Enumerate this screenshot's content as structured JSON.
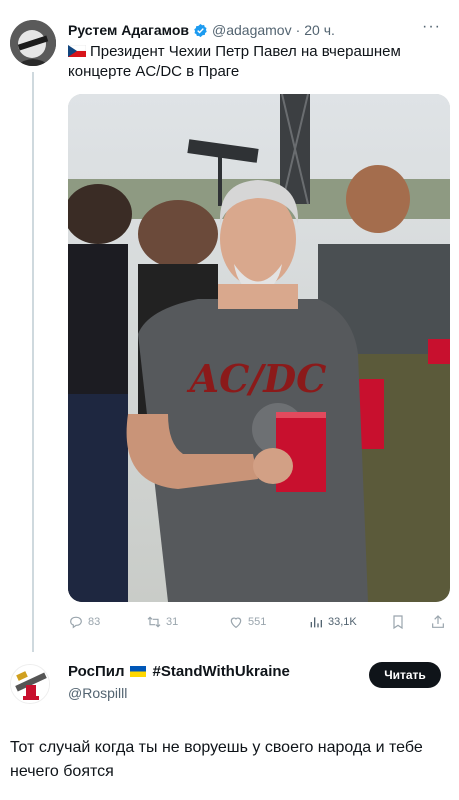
{
  "tweet": {
    "author_name": "Рустем Адагамов",
    "author_handle": "@adagamov",
    "separator": "·",
    "time": "20 ч.",
    "more": "···",
    "text": "Президент Чехии Петр Павел на вчерашнем концерте AC/DC в Праге",
    "flag": "czech-flag",
    "photo_shirt_text": "AC/DC",
    "stats": {
      "replies": "83",
      "retweets": "31",
      "likes": "551",
      "views": "33,1K"
    }
  },
  "reply_account": {
    "name": "РосПил",
    "hashtag": "#StandWithUkraine",
    "handle": "@Rospilll",
    "follow_label": "Читать"
  },
  "caption": "Тот случай когда ты не воруешь у своего народа и тебе нечего боятся",
  "colors": {
    "text": "#0f1419",
    "muted": "#536471",
    "verified": "#1d9bf0",
    "follow_bg": "#0f1419"
  }
}
